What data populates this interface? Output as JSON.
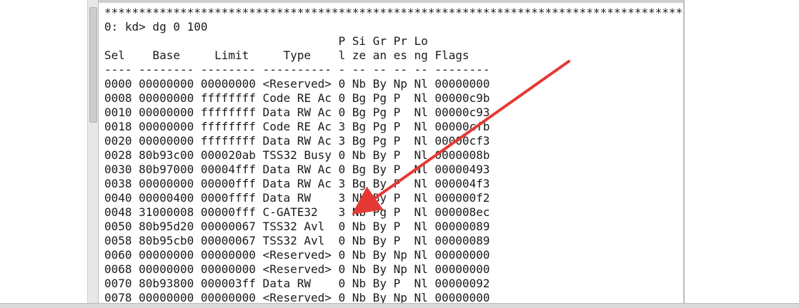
{
  "console": {
    "lines": [
      "****************************************************************************************",
      "0: kd> dg 0 100",
      "                                  P Si Gr Pr Lo",
      "Sel    Base     Limit     Type    l ze an es ng Flags",
      "---- -------- -------- ---------- - -- -- -- -- --------",
      "0000 00000000 00000000 <Reserved> 0 Nb By Np Nl 00000000",
      "0008 00000000 ffffffff Code RE Ac 0 Bg Pg P  Nl 00000c9b",
      "0010 00000000 ffffffff Data RW Ac 0 Bg Pg P  Nl 00000c93",
      "0018 00000000 ffffffff Code RE Ac 3 Bg Pg P  Nl 00000cfb",
      "0020 00000000 ffffffff Data RW Ac 3 Bg Pg P  Nl 00000cf3",
      "0028 80b93c00 000020ab TSS32 Busy 0 Nb By P  Nl 0000008b",
      "0030 80b97000 00004fff Data RW Ac 0 Bg By P  Nl 00000493",
      "0038 00000000 00000fff Data RW Ac 3 Bg By P  Nl 000004f3",
      "0040 00000400 0000ffff Data RW    3 Nb By P  Nl 000000f2",
      "0048 31000008 00000fff C-GATE32   3 Nb Pg P  Nl 000008ec",
      "0050 80b95d20 00000067 TSS32 Avl  0 Nb By P  Nl 00000089",
      "0058 80b95cb0 00000067 TSS32 Avl  0 Nb By P  Nl 00000089",
      "0060 00000000 00000000 <Reserved> 0 Nb By Np Nl 00000000",
      "0068 00000000 00000000 <Reserved> 0 Nb By Np Nl 00000000",
      "0070 80b93800 000003ff Data RW    0 Nb By P  Nl 00000092",
      "0078 00000000 00000000 <Reserved> 0 Nb By Np Nl 00000000"
    ]
  },
  "annotation": {
    "arrow_color": "#e53935",
    "icon": "arrow-annotation-icon"
  }
}
